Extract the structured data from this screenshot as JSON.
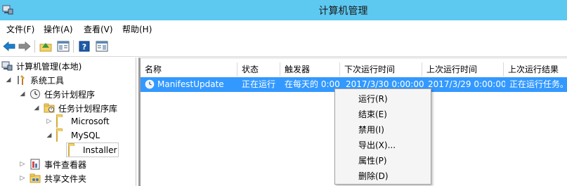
{
  "window": {
    "title": "计算机管理"
  },
  "menubar": [
    "文件(F)",
    "操作(A)",
    "查看(V)",
    "帮助(H)"
  ],
  "toolbar": {
    "buttons": [
      "back-arrow-icon",
      "forward-arrow-icon",
      "up-folder-icon",
      "show-hide-tree-icon",
      "help-icon",
      "properties-pane-icon"
    ]
  },
  "tree": {
    "root": "计算机管理(本地)",
    "system_tools": "系统工具",
    "task_scheduler": "任务计划程序",
    "task_library": "任务计划程序库",
    "microsoft": "Microsoft",
    "mysql": "MySQL",
    "installer": "Installer",
    "event_viewer": "事件查看器",
    "shared_folders": "共享文件夹"
  },
  "list": {
    "columns": [
      "名称",
      "状态",
      "触发器",
      "下次运行时间",
      "上次运行时间",
      "上次运行结果"
    ],
    "rows": [
      {
        "name": "ManifestUpdate",
        "status": "正在运行",
        "trigger": "在每天的 0:00",
        "next_run": "2017/3/30 0:00:00",
        "last_run": "2017/3/29 0:00:00",
        "last_result": "正在运行任务。"
      }
    ]
  },
  "context_menu": {
    "items": [
      "运行(R)",
      "结束(E)",
      "禁用(I)",
      "导出(X)...",
      "属性(P)",
      "删除(D)"
    ]
  },
  "colors": {
    "titlebar": "#5dc8f0",
    "selection": "#3399ff"
  }
}
